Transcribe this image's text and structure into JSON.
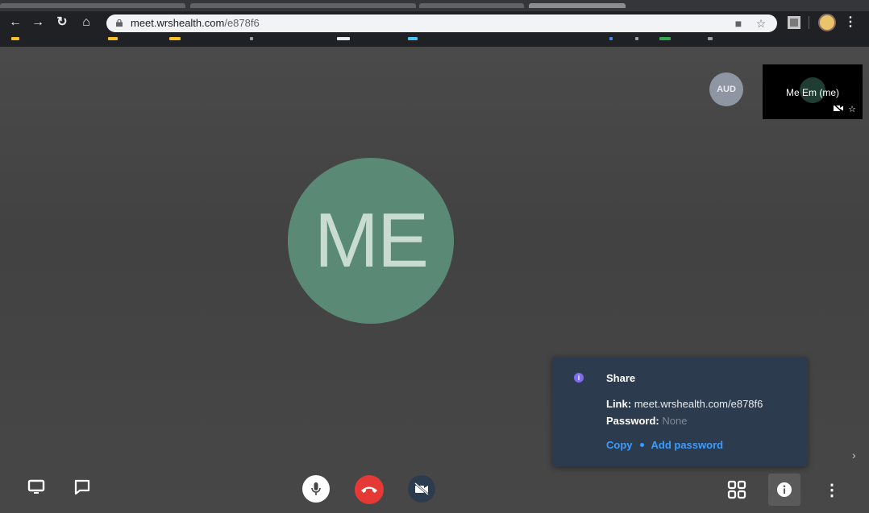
{
  "browser": {
    "url_host": "meet.wrshealth.com",
    "url_path": "/e878f6"
  },
  "participants": {
    "main_initials": "ME",
    "aud_badge": "AUD",
    "self_name": "Me Em (me)"
  },
  "share_panel": {
    "title": "Share",
    "link_label": "Link:",
    "link_value": "meet.wrshealth.com/e878f6",
    "password_label": "Password:",
    "password_value": "None",
    "copy_label": "Copy",
    "add_password_label": "Add password"
  },
  "colors": {
    "end_call": "#e53935",
    "avatar_bg": "#5a8a75",
    "link_blue": "#3b9cff"
  }
}
